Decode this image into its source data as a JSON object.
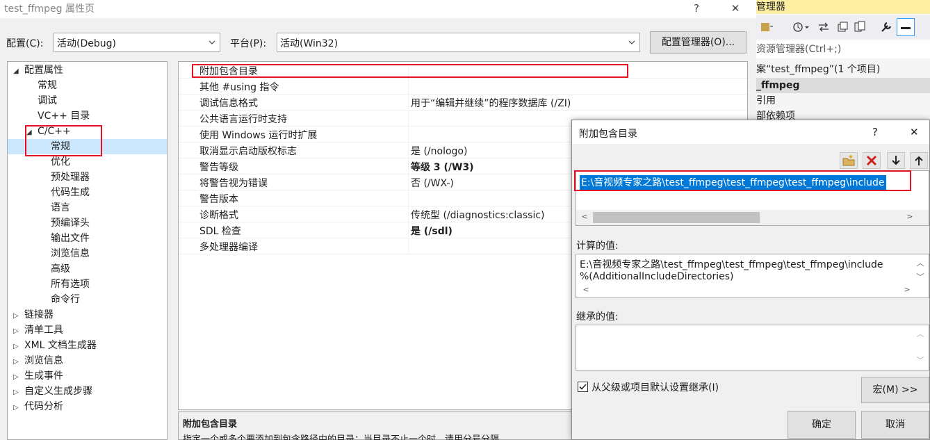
{
  "window": {
    "title": "test_ffmpeg 属性页",
    "help": "?",
    "close": "✕"
  },
  "config": {
    "label": "配置(C):",
    "value": "活动(Debug)",
    "platform_label": "平台(P):",
    "platform_value": "活动(Win32)",
    "manager_button": "配置管理器(O)..."
  },
  "tree": [
    {
      "label": "配置属性",
      "expand": "◢"
    },
    {
      "label": "常规"
    },
    {
      "label": "调试"
    },
    {
      "label": "VC++ 目录"
    },
    {
      "label": "C/C++",
      "expand": "◢"
    },
    {
      "label": "常规"
    },
    {
      "label": "优化"
    },
    {
      "label": "预处理器"
    },
    {
      "label": "代码生成"
    },
    {
      "label": "语言"
    },
    {
      "label": "预编译头"
    },
    {
      "label": "输出文件"
    },
    {
      "label": "浏览信息"
    },
    {
      "label": "高级"
    },
    {
      "label": "所有选项"
    },
    {
      "label": "命令行"
    },
    {
      "label": "链接器",
      "expand": "▷"
    },
    {
      "label": "清单工具",
      "expand": "▷"
    },
    {
      "label": "XML 文档生成器",
      "expand": "▷"
    },
    {
      "label": "浏览信息",
      "expand": "▷"
    },
    {
      "label": "生成事件",
      "expand": "▷"
    },
    {
      "label": "自定义生成步骤",
      "expand": "▷"
    },
    {
      "label": "代码分析",
      "expand": "▷"
    }
  ],
  "properties": [
    {
      "name": "附加包含目录",
      "value": ""
    },
    {
      "name": "其他 #using 指令",
      "value": ""
    },
    {
      "name": "调试信息格式",
      "value": "用于“编辑并继续”的程序数据库 (/ZI)"
    },
    {
      "name": "公共语言运行时支持",
      "value": ""
    },
    {
      "name": "使用 Windows 运行时扩展",
      "value": ""
    },
    {
      "name": "取消显示启动版权标志",
      "value": "是 (/nologo)"
    },
    {
      "name": "警告等级",
      "value": "等级 3 (/W3)"
    },
    {
      "name": "将警告视为错误",
      "value": "否 (/WX-)"
    },
    {
      "name": "警告版本",
      "value": ""
    },
    {
      "name": "诊断格式",
      "value": "传统型 (/diagnostics:classic)"
    },
    {
      "name": "SDL 检查",
      "value": "是 (/sdl)"
    },
    {
      "name": "多处理器编译",
      "value": ""
    }
  ],
  "description": {
    "title": "附加包含目录",
    "text": "指定一个或多个要添加到包含路径中的目录；当目录不止一个时，请用分号分隔"
  },
  "solution_explorer": {
    "header": "管理器",
    "search": "资源管理器(Ctrl+;)",
    "rows": [
      "案“test_ffmpeg”(1 个项目)",
      "_ffmpeg",
      "引用",
      "部依赖项"
    ]
  },
  "dialog": {
    "title": "附加包含目录",
    "help": "?",
    "close": "✕",
    "entry": "E:\\音视频专家之路\\test_ffmpeg\\test_ffmpeg\\test_ffmpeg\\include",
    "computed_label": "计算的值:",
    "computed_line1": "E:\\音视频专家之路\\test_ffmpeg\\test_ffmpeg\\test_ffmpeg\\include",
    "computed_line2": "%(AdditionalIncludeDirectories)",
    "inherited_label": "继承的值:",
    "inherit_checkbox": "从父级或项目默认设置继承(I)",
    "macro_button": "宏(M) >>",
    "ok_button": "确定",
    "cancel_button": "取消"
  },
  "colors": {
    "highlight": "#e81123",
    "selection": "#0078d7",
    "tree_selected": "#cce8ff"
  }
}
